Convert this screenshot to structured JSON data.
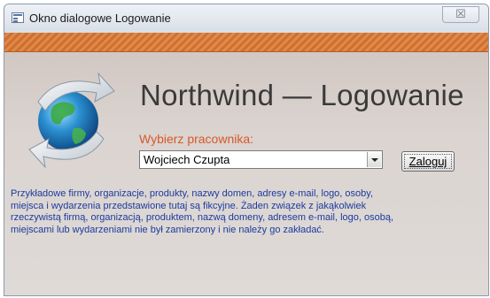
{
  "window": {
    "title": "Okno dialogowe Logowanie",
    "close_label": "☒"
  },
  "header": {
    "heading": "Northwind — Logowanie"
  },
  "form": {
    "prompt": "Wybierz pracownika:",
    "employee_selected": "Wojciech Czupta",
    "login_label": "Zaloguj"
  },
  "disclaimer": {
    "lines": [
      "Przykładowe firmy, organizacje, produkty, nazwy domen, adresy e-mail, logo, osoby,",
      "miejsca i wydarzenia przedstawione tutaj są fikcyjne. Żaden związek z jakąkolwiek",
      "rzeczywistą firmą, organizacją, produktem, nazwą domeny, adresem e-mail, logo, osobą,",
      "miejscami lub wydarzeniami nie był zamierzony i nie należy go zakładać."
    ]
  },
  "colors": {
    "accent_orange": "#d5592a",
    "disclaimer_blue": "#1c3aa0",
    "stripe": "#e08a4a"
  },
  "icons": [
    "form-window-icon",
    "globe-arrows-logo",
    "dropdown-arrow-icon"
  ]
}
